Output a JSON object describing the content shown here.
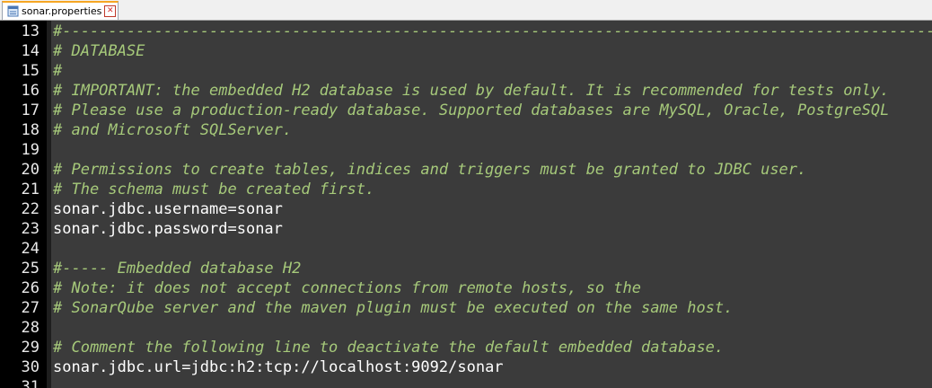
{
  "tab": {
    "filename": "sonar.properties",
    "icon": "properties-file-icon",
    "close_glyph": "✕"
  },
  "colors": {
    "editor_bg": "#3b3b3b",
    "gutter_bg": "#000000",
    "comment": "#a6c97a",
    "text": "#ffffff"
  },
  "lines": [
    {
      "num": "13",
      "type": "comment",
      "text": "#-------------------------------------------------------------------------------------------------"
    },
    {
      "num": "14",
      "type": "comment",
      "text": "# DATABASE"
    },
    {
      "num": "15",
      "type": "comment",
      "text": "#"
    },
    {
      "num": "16",
      "type": "comment",
      "text": "# IMPORTANT: the embedded H2 database is used by default. It is recommended for tests only."
    },
    {
      "num": "17",
      "type": "comment",
      "text": "# Please use a production-ready database. Supported databases are MySQL, Oracle, PostgreSQL"
    },
    {
      "num": "18",
      "type": "comment",
      "text": "# and Microsoft SQLServer."
    },
    {
      "num": "19",
      "type": "blank",
      "text": ""
    },
    {
      "num": "20",
      "type": "comment",
      "text": "# Permissions to create tables, indices and triggers must be granted to JDBC user."
    },
    {
      "num": "21",
      "type": "comment",
      "text": "# The schema must be created first."
    },
    {
      "num": "22",
      "type": "property",
      "key": "sonar.jdbc.username",
      "eq": "=",
      "value": "sonar"
    },
    {
      "num": "23",
      "type": "property",
      "key": "sonar.jdbc.password",
      "eq": "=",
      "value": "sonar"
    },
    {
      "num": "24",
      "type": "blank",
      "text": ""
    },
    {
      "num": "25",
      "type": "comment",
      "text": "#----- Embedded database H2"
    },
    {
      "num": "26",
      "type": "comment",
      "text": "# Note: it does not accept connections from remote hosts, so the"
    },
    {
      "num": "27",
      "type": "comment",
      "text": "# SonarQube server and the maven plugin must be executed on the same host."
    },
    {
      "num": "28",
      "type": "blank",
      "text": ""
    },
    {
      "num": "29",
      "type": "comment",
      "text": "# Comment the following line to deactivate the default embedded database."
    },
    {
      "num": "30",
      "type": "property",
      "key": "sonar.jdbc.url",
      "eq": "=",
      "value": "jdbc:h2:tcp://localhost:9092/sonar"
    },
    {
      "num": "31",
      "type": "blank",
      "text": ""
    }
  ]
}
